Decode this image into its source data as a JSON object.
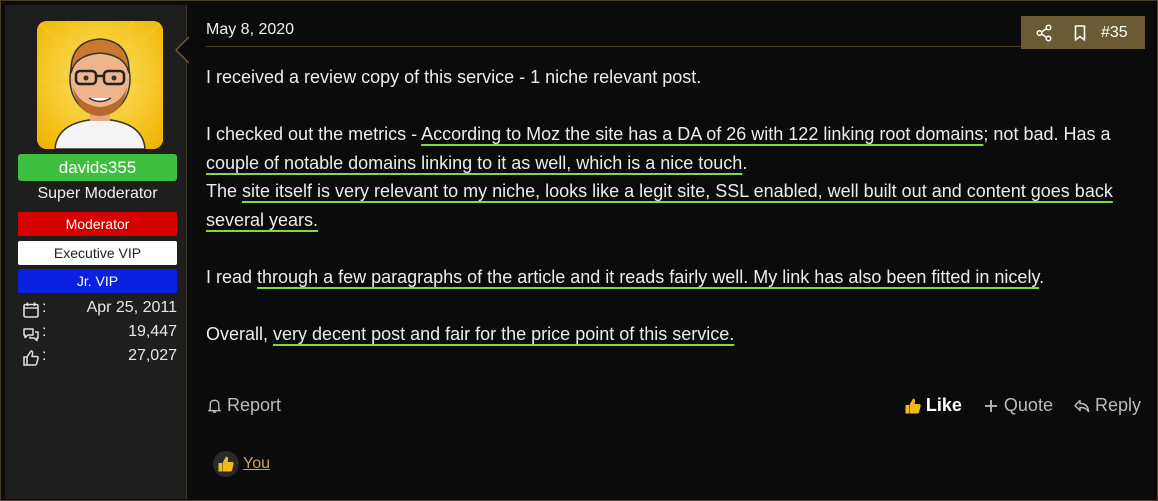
{
  "user": {
    "username": "davids355",
    "title": "Super Moderator",
    "banners": [
      "Moderator",
      "Executive VIP",
      "Jr. VIP"
    ],
    "stats": [
      {
        "icon": "calendar-icon",
        "value": "Apr 25, 2011"
      },
      {
        "icon": "messages-icon",
        "value": "19,447"
      },
      {
        "icon": "thumbs-up-icon",
        "value": "27,027"
      }
    ],
    "colon": ":"
  },
  "post": {
    "date": "May 8, 2020",
    "number": "#35",
    "paragraphs": {
      "p1": "I received a review copy of this service - 1 niche relevant post.",
      "p2a": "I checked out the metrics - ",
      "p2b": "According to Moz the site has a DA of 26 with 122 linking root domains",
      "p2c": "; not bad. Has a ",
      "p2d": "couple of notable domains linking to it as well, which is a nice touch",
      "p2e": ".",
      "p3a": "The ",
      "p3b": "site itself is very relevant to my niche, looks like a legit site, SSL enabled, well built out and content goes back several years.",
      "p4a": "I read ",
      "p4b": "through a few paragraphs of the article and it reads fairly well. My link has also been fitted in nicely",
      "p4c": ".",
      "p5a": "Overall, ",
      "p5b": "very decent post and fair for the price point of this service."
    }
  },
  "actions": {
    "report": "Report",
    "like": "Like",
    "quote": "Quote",
    "reply": "Reply"
  },
  "reactions": {
    "who": "You"
  },
  "colors": {
    "accent_gold": "#6b5a34",
    "username_green": "#3fbf3f",
    "moderator_red": "#d60000",
    "jr_vip_blue": "#0a22e0",
    "highlight_underline": "#86d93a"
  }
}
